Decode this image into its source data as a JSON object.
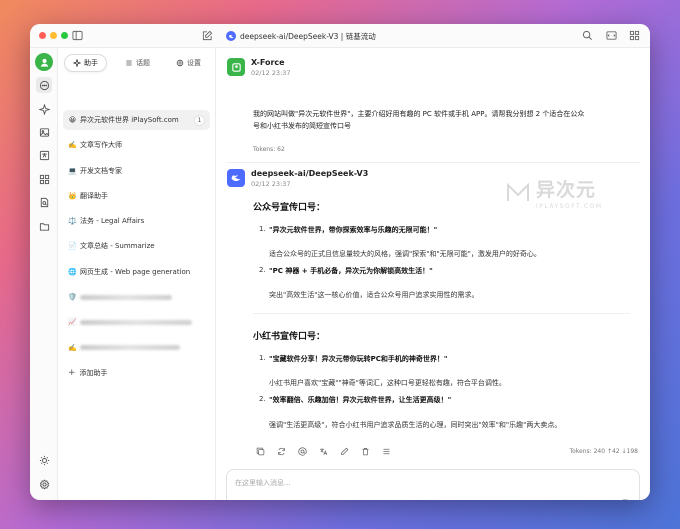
{
  "window": {
    "title": "deepseek-ai/DeepSeek-V3 | 链基流动"
  },
  "panel_tabs": [
    {
      "label": "助手",
      "icon": "sparkle-icon",
      "active": true
    },
    {
      "label": "话题",
      "icon": "list-icon",
      "active": false
    },
    {
      "label": "设置",
      "icon": "gear-icon",
      "active": false
    }
  ],
  "assistants": [
    {
      "emoji": "😀",
      "label": "异次元软件世界 iPlaySoft.com",
      "count": "1",
      "active": true
    },
    {
      "emoji": "✍️",
      "label": "文章写作大师"
    },
    {
      "emoji": "💻",
      "label": "开发文档专家"
    },
    {
      "emoji": "👑",
      "label": "翻译助手"
    },
    {
      "emoji": "⚖️",
      "label": "法务 - Legal Affairs"
    },
    {
      "emoji": "📄",
      "label": "文章总结 - Summarize"
    },
    {
      "emoji": "🌐",
      "label": "网页生成 - Web page generation"
    },
    {
      "emoji": "🛡️",
      "label": ""
    },
    {
      "emoji": "📈",
      "label": ""
    },
    {
      "emoji": "✍️",
      "label": ""
    }
  ],
  "add_assistant_label": "添加助手",
  "user_message": {
    "sender": "X-Force",
    "time": "02/12 23:37",
    "text_line1": "我的网站叫做\"异次元软件世界\"，主要介绍好用有趣的 PC 软件或手机 APP。请帮我分别想 2 个适合在公众",
    "text_line2": "号和小红书发布的简短宣传口号",
    "tokens": "Tokens: 62"
  },
  "ai_message": {
    "sender": "deepseek-ai/DeepSeek-V3",
    "time": "02/12 23:37",
    "section1_title": "公众号宣传口号：",
    "section1_items": [
      {
        "num": "1.",
        "slogan": "\"异次元软件世界，带你探索效率与乐趣的无限可能！\"",
        "desc": "适合公众号的正式且信息量较大的风格，强调\"探索\"和\"无限可能\"，激发用户的好奇心。"
      },
      {
        "num": "2.",
        "slogan": "\"PC 神器 + 手机必备，异次元为你解锁高效生活！\"",
        "desc": "突出\"高效生活\"这一核心价值，适合公众号用户追求实用性的需求。"
      }
    ],
    "section2_title": "小红书宣传口号：",
    "section2_items": [
      {
        "num": "1.",
        "slogan": "\"宝藏软件分享！异次元带你玩转PC和手机的神奇世界！\"",
        "desc": "小红书用户喜欢\"宝藏\"\"神奇\"等词汇，这种口号更轻松有趣，符合平台调性。"
      },
      {
        "num": "2.",
        "slogan": "\"效率翻倍、乐趣加倍！异次元软件世界，让生活更高级！\"",
        "desc": "强调\"生活更高级\"，符合小红书用户追求品质生活的心理，同时突出\"效率\"和\"乐趣\"两大卖点。"
      }
    ],
    "tokens": "Tokens: 240 ↑42 ↓198"
  },
  "watermark": {
    "cn": "异次元",
    "en": "IPLAYSOFT.COM"
  },
  "input": {
    "placeholder": "在这里输入消息..."
  }
}
